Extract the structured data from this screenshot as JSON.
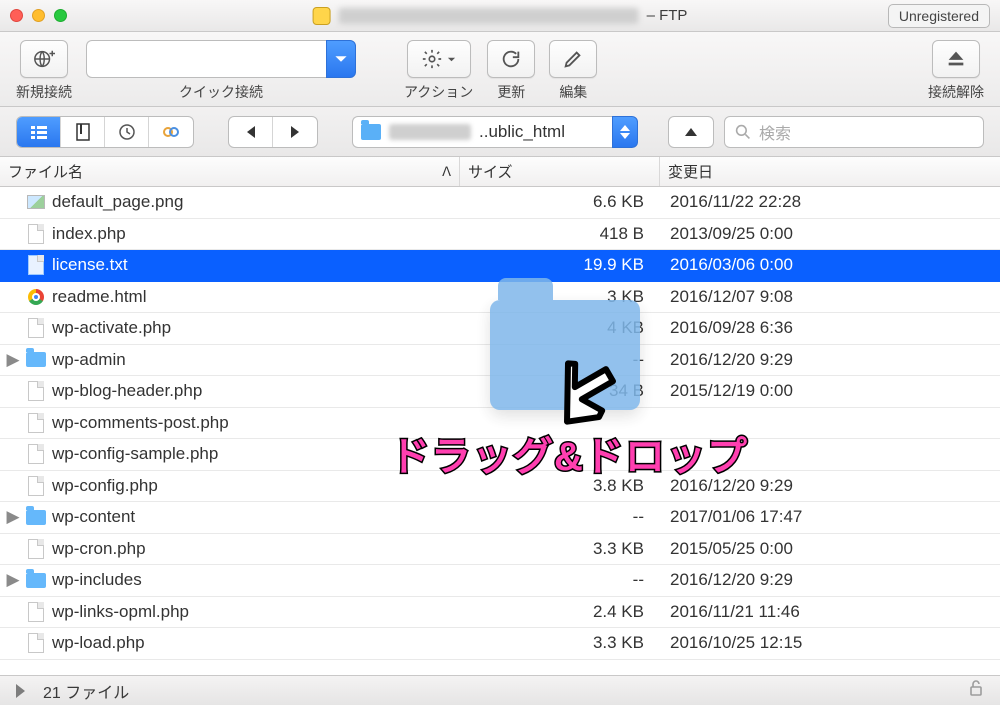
{
  "window": {
    "title_suffix": " – FTP",
    "unregistered": "Unregistered"
  },
  "toolbar": {
    "new_connection": "新規接続",
    "quick_connect": "クイック接続",
    "action": "アクション",
    "refresh": "更新",
    "edit": "編集",
    "disconnect": "接続解除"
  },
  "path": {
    "suffix": "..ublic_html"
  },
  "search": {
    "placeholder": "検索"
  },
  "columns": {
    "name": "ファイル名",
    "size": "サイズ",
    "date": "変更日",
    "sort_indicator": "ᐱ"
  },
  "files": [
    {
      "name": "default_page.png",
      "size": "6.6 KB",
      "date": "2016/11/22 22:28",
      "type": "image",
      "folder": false,
      "selected": false
    },
    {
      "name": "index.php",
      "size": "418 B",
      "date": "2013/09/25 0:00",
      "type": "file",
      "folder": false,
      "selected": false
    },
    {
      "name": "license.txt",
      "size": "19.9 KB",
      "date": "2016/03/06 0:00",
      "type": "file",
      "folder": false,
      "selected": true
    },
    {
      "name": "readme.html",
      "size": "3 KB",
      "date": "2016/12/07 9:08",
      "type": "chrome",
      "folder": false,
      "selected": false
    },
    {
      "name": "wp-activate.php",
      "size": "4 KB",
      "date": "2016/09/28 6:36",
      "type": "file",
      "folder": false,
      "selected": false
    },
    {
      "name": "wp-admin",
      "size": "--",
      "date": "2016/12/20 9:29",
      "type": "folder",
      "folder": true,
      "selected": false
    },
    {
      "name": "wp-blog-header.php",
      "size": "34 B",
      "date": "2015/12/19 0:00",
      "type": "file",
      "folder": false,
      "selected": false
    },
    {
      "name": "wp-comments-post.php",
      "size": "",
      "date": "",
      "type": "file",
      "folder": false,
      "selected": false
    },
    {
      "name": "wp-config-sample.php",
      "size": "",
      "date": "",
      "type": "file",
      "folder": false,
      "selected": false
    },
    {
      "name": "wp-config.php",
      "size": "3.8 KB",
      "date": "2016/12/20 9:29",
      "type": "file",
      "folder": false,
      "selected": false
    },
    {
      "name": "wp-content",
      "size": "--",
      "date": "2017/01/06 17:47",
      "type": "folder",
      "folder": true,
      "selected": false
    },
    {
      "name": "wp-cron.php",
      "size": "3.3 KB",
      "date": "2015/05/25 0:00",
      "type": "file",
      "folder": false,
      "selected": false
    },
    {
      "name": "wp-includes",
      "size": "--",
      "date": "2016/12/20 9:29",
      "type": "folder",
      "folder": true,
      "selected": false
    },
    {
      "name": "wp-links-opml.php",
      "size": "2.4 KB",
      "date": "2016/11/21 11:46",
      "type": "file",
      "folder": false,
      "selected": false
    },
    {
      "name": "wp-load.php",
      "size": "3.3 KB",
      "date": "2016/10/25 12:15",
      "type": "file",
      "folder": false,
      "selected": false
    }
  ],
  "status": {
    "count_text": "21 ファイル"
  },
  "annotation": {
    "text": "ドラッグ&ドロップ"
  }
}
